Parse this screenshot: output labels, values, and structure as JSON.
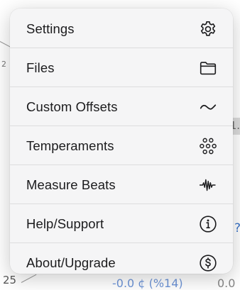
{
  "background": {
    "left_digit": "2",
    "right_digit": "1.",
    "question_mark": "?",
    "bottom_number": "25",
    "bottom_readout": "-0.0 ¢ (%14)",
    "bottom_right": "0.0"
  },
  "menu": {
    "items": [
      {
        "label": "Settings",
        "icon": "gear-icon"
      },
      {
        "label": "Files",
        "icon": "folder-icon"
      },
      {
        "label": "Custom Offsets",
        "icon": "tilde-wave-icon"
      },
      {
        "label": "Temperaments",
        "icon": "circles-cluster-icon"
      },
      {
        "label": "Measure Beats",
        "icon": "waveform-icon"
      },
      {
        "label": "Help/Support",
        "icon": "info-icon"
      },
      {
        "label": "About/Upgrade",
        "icon": "dollar-icon"
      }
    ]
  },
  "colors": {
    "menu_background": "#f5f5f6",
    "separator": "#dcdcdd",
    "text": "#1b1b1d",
    "background_accent": "#3b74c8"
  }
}
